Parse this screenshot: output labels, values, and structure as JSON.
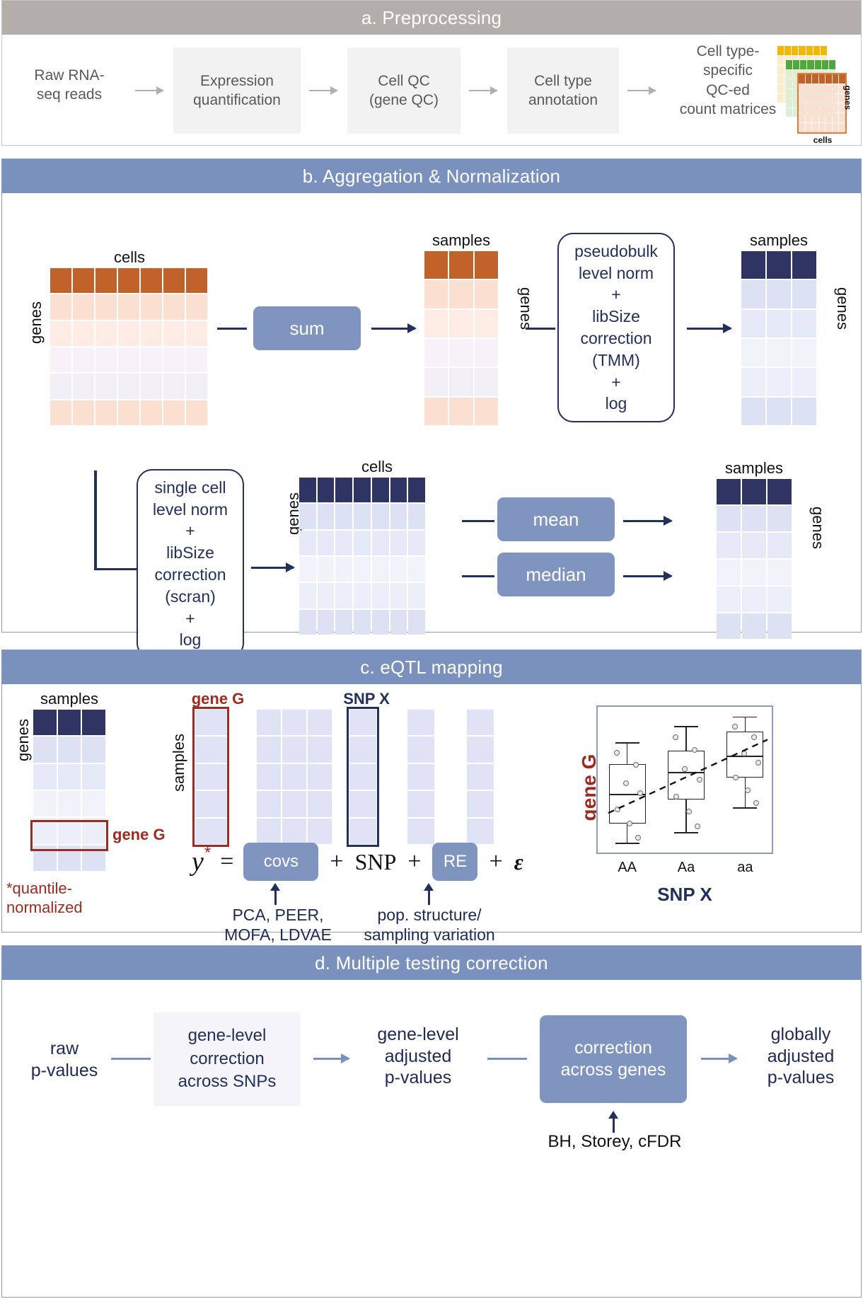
{
  "figure": {
    "panels": [
      {
        "id": "a",
        "title": "a. Preprocessing"
      },
      {
        "id": "b",
        "title": "b. Aggregation & Normalization"
      },
      {
        "id": "c",
        "title": "c. eQTL mapping"
      },
      {
        "id": "d",
        "title": "d. Multiple testing correction"
      }
    ]
  },
  "colors": {
    "header_grey": "#b3aeaa",
    "header_blue": "#7a90bd",
    "pill_blue": "#7f95c0",
    "navy": "#22305e",
    "red": "#9e2a20",
    "orange_header": "#c0622a",
    "orange_light": "#fbe0d2",
    "lavender": "#dfe3f5",
    "grey_box": "#f2f2f2"
  },
  "panel_a": {
    "title": "a. Preprocessing",
    "steps": [
      {
        "label": "Raw RNA-\nseq reads",
        "type": "text"
      },
      {
        "label": "Expression\nquantification",
        "type": "box"
      },
      {
        "label": "Cell QC\n(gene QC)",
        "type": "box"
      },
      {
        "label": "Cell type\nannotation",
        "type": "box"
      },
      {
        "label": "Cell type-\nspecific\nQC-ed\ncount matrices",
        "type": "text"
      }
    ],
    "matrix_icon": {
      "axis_right": "genes",
      "axis_bottom": "cells",
      "stack": [
        "yellow",
        "green",
        "orange"
      ]
    }
  },
  "panel_b": {
    "title": "b. Aggregation & Normalization",
    "row1": {
      "matrix_in": {
        "top_label": "cells",
        "side_label": "genes",
        "cols": 7,
        "rows": 6,
        "header_color": "#c0622a"
      },
      "op": "sum",
      "matrix_mid": {
        "top_label": "samples",
        "side_label": "genes",
        "cols": 3,
        "rows": 6,
        "header_color": "#c0622a"
      },
      "process": "pseudobulk\nlevel norm\n+\nlibSize\ncorrection\n(TMM)\n+\nlog",
      "matrix_out": {
        "top_label": "samples",
        "side_label": "genes",
        "cols": 3,
        "rows": 6,
        "header_color": "#2f3463"
      }
    },
    "row2": {
      "process": "single cell\nlevel norm\n+\nlibSize\ncorrection\n(scran)\n+\nlog",
      "matrix_mid": {
        "top_label": "cells",
        "side_label": "genes",
        "cols": 7,
        "rows": 6,
        "header_color": "#2f3463"
      },
      "ops": [
        "mean",
        "median"
      ],
      "matrix_out": {
        "top_label": "samples",
        "side_label": "genes",
        "cols": 3,
        "rows": 6,
        "header_color": "#2f3463"
      }
    }
  },
  "panel_c": {
    "title": "c. eQTL mapping",
    "matrix": {
      "top_label": "samples",
      "side_label": "genes",
      "cols": 3,
      "rows": 6,
      "header_color": "#2f3463"
    },
    "gene_highlight_label": "gene G",
    "footnote": "*quantile-\nnormalized",
    "vectors": {
      "gene_label": "gene G",
      "samples_label": "samples",
      "snp_label": "SNP X"
    },
    "equation": {
      "response": "y",
      "star": "*",
      "equals": "=",
      "covs": "covs",
      "plus1": "+",
      "snp": "SNP",
      "plus2": "+",
      "re": "RE",
      "plus3": "+",
      "epsilon": "ε",
      "covs_note": "PCA, PEER,\nMOFA, LDVAE",
      "re_note": "pop. structure/\nsampling variation"
    },
    "boxplot": {
      "ylabel": "gene G",
      "xlabel": "SNP X",
      "categories": [
        "AA",
        "Aa",
        "aa"
      ],
      "trend": "increasing dashed regression line"
    }
  },
  "panel_d": {
    "title": "d. Multiple testing correction",
    "steps": [
      {
        "label": "raw\np-values",
        "type": "text"
      },
      {
        "label": "gene-level\ncorrection\nacross SNPs",
        "type": "lightbox"
      },
      {
        "label": "gene-level\nadjusted\np-values",
        "type": "text"
      },
      {
        "label": "correction\nacross genes",
        "type": "pill"
      },
      {
        "label": "globally\nadjusted\np-values",
        "type": "text"
      }
    ],
    "annotation": "BH, Storey, cFDR"
  },
  "chart_data": {
    "type": "box",
    "title": "eQTL boxplot",
    "xlabel": "SNP X",
    "ylabel": "gene G",
    "categories": [
      "AA",
      "Aa",
      "aa"
    ],
    "boxes": [
      {
        "category": "AA",
        "min": 0.04,
        "q1": 0.18,
        "median": 0.4,
        "q3": 0.62,
        "max": 0.78
      },
      {
        "category": "Aa",
        "min": 0.12,
        "q1": 0.36,
        "median": 0.56,
        "q3": 0.72,
        "max": 0.9
      },
      {
        "category": "aa",
        "min": 0.3,
        "q1": 0.52,
        "median": 0.68,
        "q3": 0.86,
        "max": 0.97
      }
    ],
    "points_per_box": 7,
    "trendline": {
      "from": [
        0.06,
        0.26
      ],
      "to": [
        0.96,
        0.8
      ],
      "style": "dashed"
    },
    "grid": false,
    "legend": null
  }
}
